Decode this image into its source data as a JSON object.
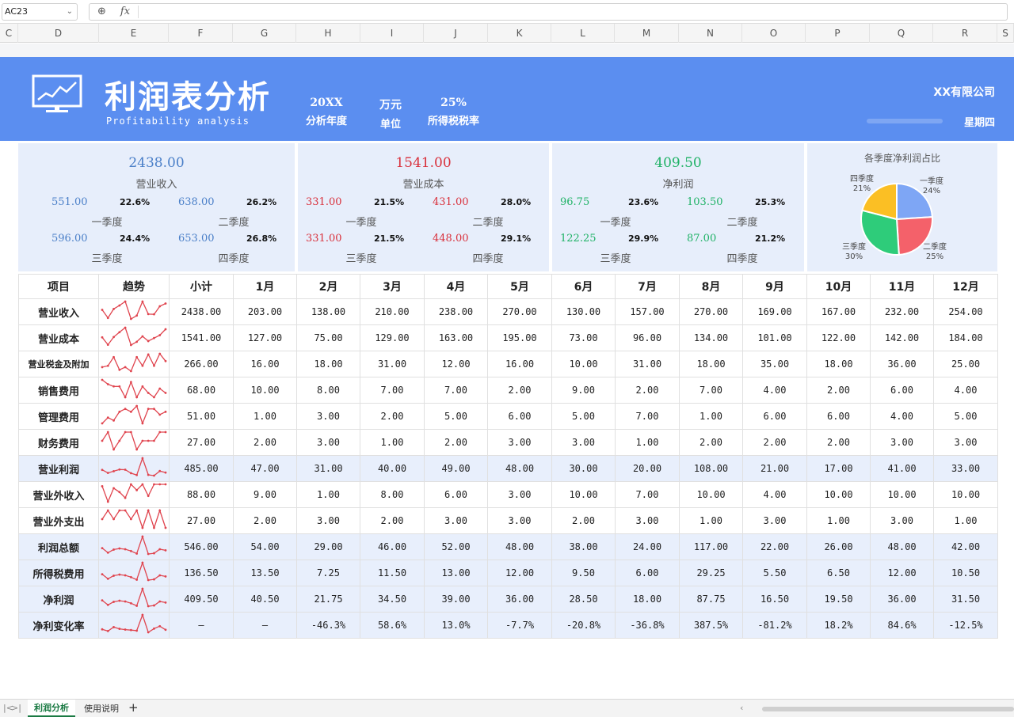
{
  "formula_bar": {
    "cell_ref": "AC23",
    "zoom_icon": "zoom-icon",
    "fx_label": "fx",
    "formula": ""
  },
  "columns": [
    "C",
    "D",
    "E",
    "F",
    "G",
    "H",
    "I",
    "J",
    "K",
    "L",
    "M",
    "N",
    "O",
    "P",
    "Q",
    "R",
    "S"
  ],
  "header": {
    "title": "利润表分析",
    "subtitle": "Profitability analysis",
    "year_value": "20XX",
    "year_label": "分析年度",
    "unit_value": "万元",
    "unit_label": "单位",
    "tax_value": "25%",
    "tax_label": "所得税税率",
    "company": "XX有限公司",
    "weekday": "星期四",
    "banner_color": "#5b8ef0",
    "icon": "monitor-chart-icon"
  },
  "summary": {
    "revenue": {
      "total": "2438.00",
      "label": "营业收入",
      "quarters": [
        {
          "value": "551.00",
          "pct": "22.6%",
          "name": "一季度"
        },
        {
          "value": "638.00",
          "pct": "26.2%",
          "name": "二季度"
        },
        {
          "value": "596.00",
          "pct": "24.4%",
          "name": "三季度"
        },
        {
          "value": "653.00",
          "pct": "26.8%",
          "name": "四季度"
        }
      ]
    },
    "cost": {
      "total": "1541.00",
      "label": "营业成本",
      "quarters": [
        {
          "value": "331.00",
          "pct": "21.5%",
          "name": "一季度"
        },
        {
          "value": "431.00",
          "pct": "28.0%",
          "name": "二季度"
        },
        {
          "value": "331.00",
          "pct": "21.5%",
          "name": "三季度"
        },
        {
          "value": "448.00",
          "pct": "29.1%",
          "name": "四季度"
        }
      ]
    },
    "net": {
      "total": "409.50",
      "label": "净利润",
      "quarters": [
        {
          "value": "96.75",
          "pct": "23.6%",
          "name": "一季度"
        },
        {
          "value": "103.50",
          "pct": "25.3%",
          "name": "二季度"
        },
        {
          "value": "122.25",
          "pct": "29.9%",
          "name": "三季度"
        },
        {
          "value": "87.00",
          "pct": "21.2%",
          "name": "四季度"
        }
      ]
    },
    "colors": {
      "revenue": "#4a7fc8",
      "cost": "#d9303b",
      "net": "#1fb266"
    }
  },
  "chart_data": {
    "type": "pie",
    "title": "各季度净利润占比",
    "labels": [
      "一季度",
      "二季度",
      "三季度",
      "四季度"
    ],
    "values": [
      24,
      25,
      30,
      21
    ],
    "pct_labels": [
      "24%",
      "25%",
      "30%",
      "21%"
    ],
    "colors": [
      "#7ea6f5",
      "#f4616a",
      "#2ecc7a",
      "#fbbf24"
    ]
  },
  "table": {
    "headers": [
      "项目",
      "趋势",
      "小计",
      "1月",
      "2月",
      "3月",
      "4月",
      "5月",
      "6月",
      "7月",
      "8月",
      "9月",
      "10月",
      "11月",
      "12月"
    ],
    "trend_color": "#e0454f",
    "rows": [
      {
        "name": "营业收入",
        "subtotal": "2438.00",
        "months": [
          "203.00",
          "138.00",
          "210.00",
          "238.00",
          "270.00",
          "130.00",
          "157.00",
          "270.00",
          "169.00",
          "167.00",
          "232.00",
          "254.00"
        ],
        "trend": [
          203,
          138,
          210,
          238,
          270,
          130,
          157,
          270,
          169,
          167,
          232,
          254
        ],
        "hl": false
      },
      {
        "name": "营业成本",
        "subtotal": "1541.00",
        "months": [
          "127.00",
          "75.00",
          "129.00",
          "163.00",
          "195.00",
          "73.00",
          "96.00",
          "134.00",
          "101.00",
          "122.00",
          "142.00",
          "184.00"
        ],
        "trend": [
          127,
          75,
          129,
          163,
          195,
          73,
          96,
          134,
          101,
          122,
          142,
          184
        ],
        "hl": false
      },
      {
        "name": "营业税金及附加",
        "subtotal": "266.00",
        "months": [
          "16.00",
          "18.00",
          "31.00",
          "12.00",
          "16.00",
          "10.00",
          "31.00",
          "18.00",
          "35.00",
          "18.00",
          "36.00",
          "25.00"
        ],
        "trend": [
          16,
          18,
          31,
          12,
          16,
          10,
          31,
          18,
          35,
          18,
          36,
          25
        ],
        "hl": false
      },
      {
        "name": "销售费用",
        "subtotal": "68.00",
        "months": [
          "10.00",
          "8.00",
          "7.00",
          "7.00",
          "2.00",
          "9.00",
          "2.00",
          "7.00",
          "4.00",
          "2.00",
          "6.00",
          "4.00"
        ],
        "trend": [
          10,
          8,
          7,
          7,
          2,
          9,
          2,
          7,
          4,
          2,
          6,
          4
        ],
        "hl": false
      },
      {
        "name": "管理费用",
        "subtotal": "51.00",
        "months": [
          "1.00",
          "3.00",
          "2.00",
          "5.00",
          "6.00",
          "5.00",
          "7.00",
          "1.00",
          "6.00",
          "6.00",
          "4.00",
          "5.00"
        ],
        "trend": [
          1,
          3,
          2,
          5,
          6,
          5,
          7,
          1,
          6,
          6,
          4,
          5
        ],
        "hl": false
      },
      {
        "name": "财务费用",
        "subtotal": "27.00",
        "months": [
          "2.00",
          "3.00",
          "1.00",
          "2.00",
          "3.00",
          "3.00",
          "1.00",
          "2.00",
          "2.00",
          "2.00",
          "3.00",
          "3.00"
        ],
        "trend": [
          2,
          3,
          1,
          2,
          3,
          3,
          1,
          2,
          2,
          2,
          3,
          3
        ],
        "hl": false
      },
      {
        "name": "营业利润",
        "subtotal": "485.00",
        "months": [
          "47.00",
          "31.00",
          "40.00",
          "49.00",
          "48.00",
          "30.00",
          "20.00",
          "108.00",
          "21.00",
          "17.00",
          "41.00",
          "33.00"
        ],
        "trend": [
          47,
          31,
          40,
          49,
          48,
          30,
          20,
          108,
          21,
          17,
          41,
          33
        ],
        "hl": true
      },
      {
        "name": "营业外收入",
        "subtotal": "88.00",
        "months": [
          "9.00",
          "1.00",
          "8.00",
          "6.00",
          "3.00",
          "10.00",
          "7.00",
          "10.00",
          "4.00",
          "10.00",
          "10.00",
          "10.00"
        ],
        "trend": [
          9,
          1,
          8,
          6,
          3,
          10,
          7,
          10,
          4,
          10,
          10,
          10
        ],
        "hl": false
      },
      {
        "name": "营业外支出",
        "subtotal": "27.00",
        "months": [
          "2.00",
          "3.00",
          "2.00",
          "3.00",
          "3.00",
          "2.00",
          "3.00",
          "1.00",
          "3.00",
          "1.00",
          "3.00",
          "1.00"
        ],
        "trend": [
          2,
          3,
          2,
          3,
          3,
          2,
          3,
          1,
          3,
          1,
          3,
          1
        ],
        "hl": false
      },
      {
        "name": "利润总额",
        "subtotal": "546.00",
        "months": [
          "54.00",
          "29.00",
          "46.00",
          "52.00",
          "48.00",
          "38.00",
          "24.00",
          "117.00",
          "22.00",
          "26.00",
          "48.00",
          "42.00"
        ],
        "trend": [
          54,
          29,
          46,
          52,
          48,
          38,
          24,
          117,
          22,
          26,
          48,
          42
        ],
        "hl": true
      },
      {
        "name": "所得税费用",
        "subtotal": "136.50",
        "months": [
          "13.50",
          "7.25",
          "11.50",
          "13.00",
          "12.00",
          "9.50",
          "6.00",
          "29.25",
          "5.50",
          "6.50",
          "12.00",
          "10.50"
        ],
        "trend": [
          13.5,
          7.25,
          11.5,
          13,
          12,
          9.5,
          6,
          29.25,
          5.5,
          6.5,
          12,
          10.5
        ],
        "hl": true
      },
      {
        "name": "净利润",
        "subtotal": "409.50",
        "months": [
          "40.50",
          "21.75",
          "34.50",
          "39.00",
          "36.00",
          "28.50",
          "18.00",
          "87.75",
          "16.50",
          "19.50",
          "36.00",
          "31.50"
        ],
        "trend": [
          40.5,
          21.75,
          34.5,
          39,
          36,
          28.5,
          18,
          87.75,
          16.5,
          19.5,
          36,
          31.5
        ],
        "hl": true
      },
      {
        "name": "净利变化率",
        "subtotal": "—",
        "months": [
          "—",
          "-46.3%",
          "58.6%",
          "13.0%",
          "-7.7%",
          "-20.8%",
          "-36.8%",
          "387.5%",
          "-81.2%",
          "18.2%",
          "84.6%",
          "-12.5%"
        ],
        "trend": [
          0,
          -46.3,
          58.6,
          13.0,
          -7.7,
          -20.8,
          -36.8,
          387.5,
          -81.2,
          18.2,
          84.6,
          -12.5
        ],
        "hl": true
      }
    ]
  },
  "sheet_tabs": {
    "tabs": [
      "利润分析",
      "使用说明"
    ],
    "active": "利润分析",
    "add_label": "+"
  }
}
